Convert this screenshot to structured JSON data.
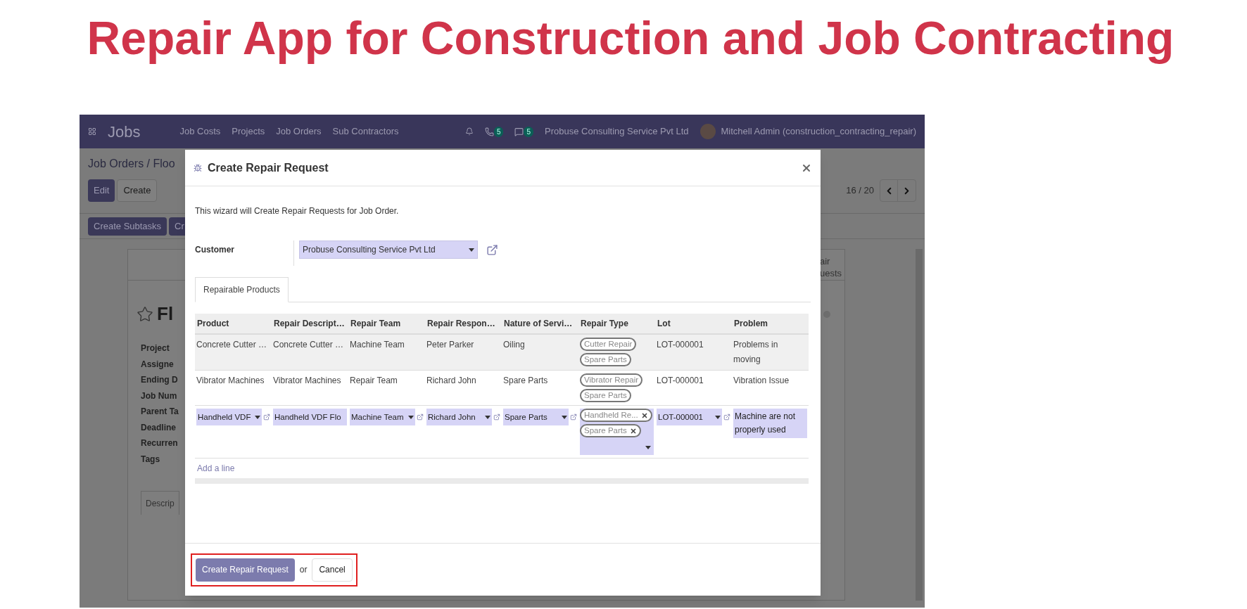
{
  "page_title": "Repair App for Construction and Job Contracting",
  "app": {
    "name": "Jobs",
    "menu": [
      "Job Costs",
      "Projects",
      "Job Orders",
      "Sub Contractors"
    ],
    "badges": [
      "5",
      "5"
    ],
    "company": "Probuse Consulting Service Pvt Ltd",
    "user": "Mitchell Admin (construction_contracting_repair)"
  },
  "breadcrumb": "Job Orders / Floo",
  "buttons": [
    {
      "label": "Edit",
      "kind": "primary"
    },
    {
      "label": "Create",
      "kind": "secondary"
    }
  ],
  "pager": "16 / 20",
  "header_buttons": [
    "Create Subtasks",
    "Cr"
  ],
  "record": {
    "title": "Fl",
    "starred": false,
    "fields": [
      "Project",
      "Assigne",
      "Ending D",
      "Job Num",
      "Parent Ta",
      "Deadline",
      "Recurren",
      "Tags"
    ],
    "tab": "Descrip",
    "smart_button": [
      "air",
      "uests"
    ]
  },
  "dialog": {
    "title": "Create Repair Request",
    "intro": "This wizard will Create Repair Requests for Job Order.",
    "customer": {
      "label": "Customer",
      "value": "Probuse Consulting Service Pvt Ltd"
    },
    "tabs": [
      {
        "label": "Repairable Products",
        "selected": true
      }
    ],
    "columns": [
      "Product",
      "Repair Descript…",
      "Repair Team",
      "Repair Respon…",
      "Nature of Servi…",
      "Repair Type",
      "Lot",
      "Problem"
    ],
    "rows": [
      {
        "selected": true,
        "cells": [
          {
            "kind": "text",
            "value": "Concrete Cutter …"
          },
          {
            "kind": "text",
            "value": "Concrete Cutter …"
          },
          {
            "kind": "text",
            "value": "Machine Team"
          },
          {
            "kind": "text",
            "value": "Peter Parker"
          },
          {
            "kind": "text",
            "value": "Oiling"
          },
          {
            "kind": "tags",
            "tags": [
              {
                "label": "Cutter Repair",
                "removable": false
              },
              {
                "label": "Spare Parts",
                "removable": false
              }
            ]
          },
          {
            "kind": "text",
            "value": "LOT-000001"
          },
          {
            "kind": "text",
            "value": "Problems in moving"
          }
        ]
      },
      {
        "selected": false,
        "cells": [
          {
            "kind": "text",
            "value": "Vibrator Machines"
          },
          {
            "kind": "text",
            "value": "Vibrator Machines"
          },
          {
            "kind": "text",
            "value": "Repair Team"
          },
          {
            "kind": "text",
            "value": "Richard John"
          },
          {
            "kind": "text",
            "value": "Spare Parts"
          },
          {
            "kind": "tags",
            "tags": [
              {
                "label": "Vibrator Repair",
                "removable": false
              },
              {
                "label": "Spare Parts",
                "removable": false
              }
            ]
          },
          {
            "kind": "text",
            "value": "LOT-000001"
          },
          {
            "kind": "text",
            "value": "Vibration Issue"
          }
        ]
      },
      {
        "selected": false,
        "cells": [
          {
            "kind": "select",
            "value": "Handheld VDF"
          },
          {
            "kind": "input",
            "value": "Handheld VDF Flo"
          },
          {
            "kind": "select",
            "value": "Machine Team"
          },
          {
            "kind": "select",
            "value": "Richard John"
          },
          {
            "kind": "select",
            "value": "Spare Parts"
          },
          {
            "kind": "tags",
            "tags": [
              {
                "label": "Handheld Re...",
                "removable": true
              },
              {
                "label": "Spare Parts",
                "removable": true
              }
            ]
          },
          {
            "kind": "select",
            "value": "LOT-000001"
          },
          {
            "kind": "textarea",
            "value": "Machine are not properly used"
          }
        ]
      }
    ],
    "add_line": "Add a line",
    "footer": {
      "primary": "Create Repair Request",
      "or": "or",
      "cancel": "Cancel"
    }
  }
}
